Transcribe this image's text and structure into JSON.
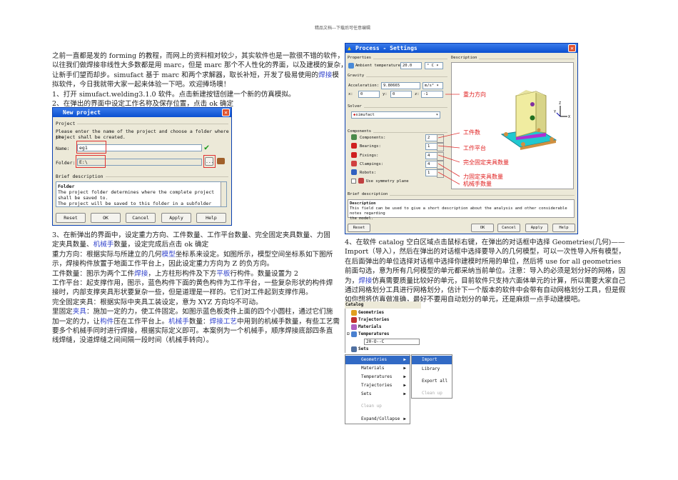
{
  "header": "精品文档---下载后可任意编辑",
  "intro": {
    "lines": [
      "之前一直都是发的 forming 的教程，而网上的资料相对较少，其实软件也是一款很不错的软件，",
      "以往我们做焊接非线性大多数都是用 marc，但是 marc 那个不人性化的界面，以及建模的复杂，",
      "让新手们望而却步。simufact 基于 marc 和两个求解器，取长补短，开发了极易使用的"
    ],
    "link1": "焊接",
    "line3_tail": "模",
    "line4": "拟软件，今日我就带大家一起来体验一下吧。欢迎捧场噢！",
    "step1": "1、打开 simufact.welding3.1.0 软件。点击新建按钮创建一个新的仿真模拟。",
    "step2": "2、在弹出的界面中设定工作名称及保存位置，点击 ok 确定"
  },
  "new_project": {
    "title": "New project",
    "group": "Project",
    "instruction1": "Please enter the name of the project and choose a folder where the",
    "instruction2": "project shall be created.",
    "name_label": "Name:",
    "name_value": "eg1",
    "folder_label": "Folder:",
    "folder_value": "E:\\",
    "browse": "...",
    "brief_label": "Brief description",
    "desc_title": "Folder",
    "desc_lines": [
      "The project folder determines where the complete project",
      "shall be saved to.",
      "The project will be saved to this folder in a subfolder named"
    ],
    "buttons": [
      "Reset",
      "OK",
      "Cancel",
      "Apply",
      "Help"
    ]
  },
  "step3": {
    "l1": "3、在新弹出的界面中，设定重力方向、工件数量、工作平台数量、完全固定夹具数量、力固",
    "l2a": "定夹具数量、",
    "l2link": "机械手",
    "l2b": "数量，设定完成后点击 ok 确定",
    "l3a": "重力方向：根据实际与所建立的几何",
    "l3link": "模型",
    "l3b": "坐标系来设定。如图所示，模型空间坐标系如下图所",
    "l4": "示，焊接构件放置于地面工作平台上，因此设定重力方向为 Z 的负方向。",
    "l5a": "工件数量：图示为两个工件",
    "l5link1": "焊接",
    "l5b": "，上方柱形构件及下方",
    "l5link2": "平板",
    "l5c": "行构件。数量设置为 2",
    "l6": "工作平台：起支撑作用，图示，蓝色构件下面的黄色构件为工作平台，一些复杂形状的构件焊",
    "l7": "接时，内部支撑夹具形状要复杂一些，但是道理是一样的。它们对工件起到支撑作用。",
    "l8": "完全固定夹具：根据实际中夹具工装设定，意为 XYZ 方向均不可动。",
    "l9a": "里固定",
    "l9link": "夹具",
    "l9b": "：施加一定的力，使工件固定。如图示蓝色板类件上面的四个小圆柱，通过它们施",
    "l10a": "加一定的力，让",
    "l10link1": "构件",
    "l10b": "压在工作平台上。",
    "l10link2": "机械手",
    "l10c": "数量：",
    "l10link3": "焊接工艺",
    "l10d": "中用到的机械手数量，有些工艺需",
    "l11": "要多个机械手同时进行焊接，根据实际定义即可。本案例为一个机械手，顺序焊接底部四条直",
    "l12": "线焊缝，没道焊缝之间间隔一段时间（机械手转向）。"
  },
  "process": {
    "title": "Process - Settings",
    "properties": "Properties",
    "ambient_label": "Ambient temperature:",
    "ambient_value": "20.0",
    "ambient_unit": "° C",
    "gravity": "Gravity",
    "accel_label": "Acceleration:",
    "accel_value": "9.80665",
    "accel_unit": "m/s²",
    "x_label": "x:",
    "x_value": "0",
    "y_label": "y:",
    "y_value": "0",
    "z_label": "z:",
    "z_value": "-1",
    "solver": "Solver",
    "solver_value": "simufact",
    "components": "Components",
    "rows": [
      {
        "label": "Components:",
        "value": "2"
      },
      {
        "label": "Bearings:",
        "value": "1"
      },
      {
        "label": "Fixings:",
        "value": "4"
      },
      {
        "label": "Clampings:",
        "value": "4"
      },
      {
        "label": "Robots:",
        "value": "1"
      }
    ],
    "symmetry": "Use symmetry plane",
    "description": "Description",
    "brief": "Brief description",
    "desc_title": "Description",
    "desc_l1": "This field can be used to give a short description about the analysis and other considerable notes regarding",
    "desc_l2": "the model.",
    "buttons": [
      "Reset",
      "OK",
      "Cancel",
      "Apply",
      "Help"
    ],
    "annotations": [
      "重力方向",
      "工件数",
      "工作平台",
      "完全固定夹具数量",
      "力固定夹具数量",
      "机械手数量"
    ],
    "axis": {
      "z": "Z",
      "x": "X",
      "y": "Y"
    }
  },
  "step4": {
    "l1": "4、在软件 catalog 空白区域点击鼠标右键，在弹出的对话框中选择 Geometries(几何)——",
    "l2": "Import（导入），然后在弹出的对话框中选择要导入的几何模型，可以一次性导入所有模型，",
    "l3": "在后面弹出的单位选择对话框中选择你建模时所用的单位，然后将 use for all geometries",
    "l4": "前面勾选，意为所有几何模型的单元都采纳当前单位。注意：导入的必须是划分好的网格，因",
    "l5a": "为，",
    "l5link": "焊接",
    "l5b": "仿真需要质量比较好的单元，目前软件只支持六面体单元的计算，所以需要大家自己",
    "l6": "通过网格划分工具进行网格划分，估计下一个版本的软件中会带有自动网格划分工具，但是假",
    "l7": "如你想将仿真做准确，最好不要用自动划分的单元，还是麻烦一点手动建模吧。"
  },
  "catalog": {
    "title": "Catalog",
    "tree": [
      "Geometries",
      "Trajectories",
      "Materials",
      "Temperatures",
      "20-O--C",
      "Sets"
    ],
    "menu": [
      "Geometries",
      "Materials",
      "Temperatures",
      "Trajectories",
      "Sets",
      "Clean up",
      "Expand/Collapse"
    ],
    "submenu": [
      "Import",
      "Library",
      "Export all",
      "Clean up"
    ]
  }
}
